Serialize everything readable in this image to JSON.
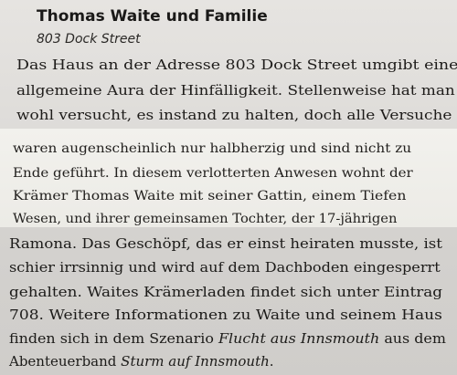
{
  "entry": {
    "title": "Thomas Waite und Familie",
    "address": "803 Dock Street"
  },
  "text_lines": [
    "Das Haus an der Adresse 803 Dock Street umgibt eine",
    "allgemeine Aura der Hinfälligkeit. Stellenweise hat man",
    "wohl versucht, es instand zu halten, doch alle Versuche",
    "waren augenscheinlich nur halbherzig und sind nicht zu",
    "Ende geführt. In diesem verlotterten Anwesen wohnt der",
    "Krämer Thomas Waite mit seiner Gattin, einem Tiefen",
    "Wesen, und ihrer gemeinsamen Tochter, der 17-jährigen",
    "Ramona. Das Geschöpf, das er einst heiraten musste, ist",
    "schier irrsinnig und wird auf dem Dachboden eingesperrt",
    "gehalten. Waites Krämerladen findet sich unter Eintrag",
    "708. Weitere Informationen zu Waite und seinem Haus"
  ],
  "line_12": {
    "before": "finden sich in dem Szenario ",
    "italic": "Flucht aus Innsmouth",
    "after": " aus dem"
  },
  "line_13": {
    "before": "Abenteuerband ",
    "italic": "Sturm auf Innsmouth",
    "after": "."
  }
}
